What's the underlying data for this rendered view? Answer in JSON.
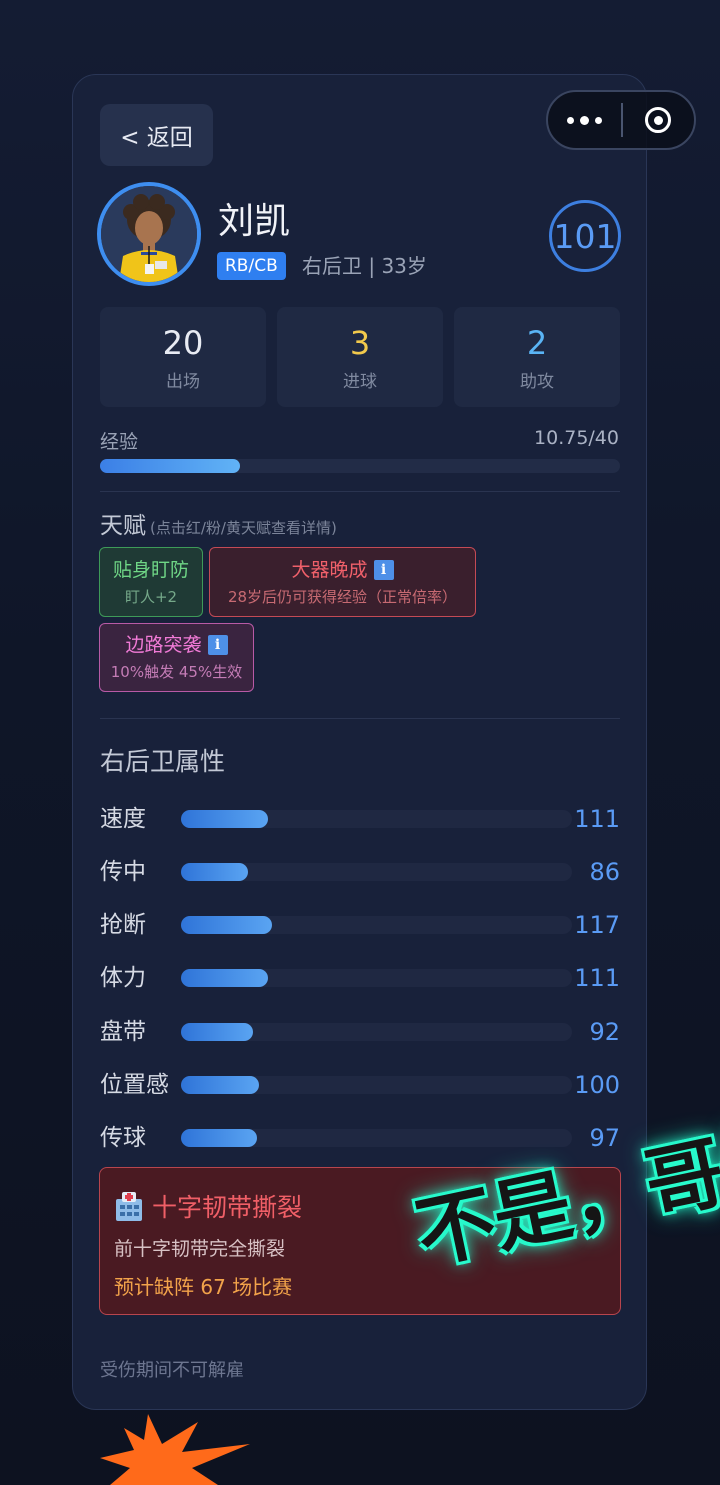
{
  "header": {
    "back_label": "< 返回"
  },
  "player": {
    "name": "刘凯",
    "position_badge": "RB/CB",
    "subinfo": "右后卫 | 33岁",
    "rating": "101"
  },
  "stats": [
    {
      "value": "20",
      "label": "出场",
      "color": "#e8ebf3"
    },
    {
      "value": "3",
      "label": "进球",
      "color": "#f2c94c"
    },
    {
      "value": "2",
      "label": "助攻",
      "color": "#5ab4f5"
    }
  ],
  "experience": {
    "label": "经验",
    "value_text": "10.75/40",
    "current": 10.75,
    "max": 40
  },
  "talents": {
    "title": "天赋",
    "hint": "(点击红/粉/黄天赋查看详情)",
    "items": [
      {
        "name": "贴身盯防",
        "desc": "盯人+2",
        "color": "green",
        "info": false
      },
      {
        "name": "大器晚成",
        "desc": "28岁后仍可获得经验（正常倍率）",
        "color": "red",
        "info": true
      },
      {
        "name": "边路突袭",
        "desc": "10%触发 45%生效",
        "color": "pink",
        "info": true
      }
    ],
    "info_glyph": "i"
  },
  "attributes": {
    "title": "右后卫属性",
    "scale_max": 500,
    "items": [
      {
        "name": "速度",
        "value": 111
      },
      {
        "name": "传中",
        "value": 86
      },
      {
        "name": "抢断",
        "value": 117
      },
      {
        "name": "体力",
        "value": 111
      },
      {
        "name": "盘带",
        "value": 92
      },
      {
        "name": "位置感",
        "value": 100
      },
      {
        "name": "传球",
        "value": 97
      }
    ]
  },
  "injury": {
    "title": "十字韧带撕裂",
    "description": "前十字韧带完全撕裂",
    "outlook": "预计缺阵 67 场比赛"
  },
  "footnote": "受伤期间不可解雇",
  "sticker": {
    "text": "不是，哥们",
    "glow_color": "#2bffd0"
  },
  "colors": {
    "accent": "#3e8ef0",
    "burst": "#ff6a1a"
  }
}
